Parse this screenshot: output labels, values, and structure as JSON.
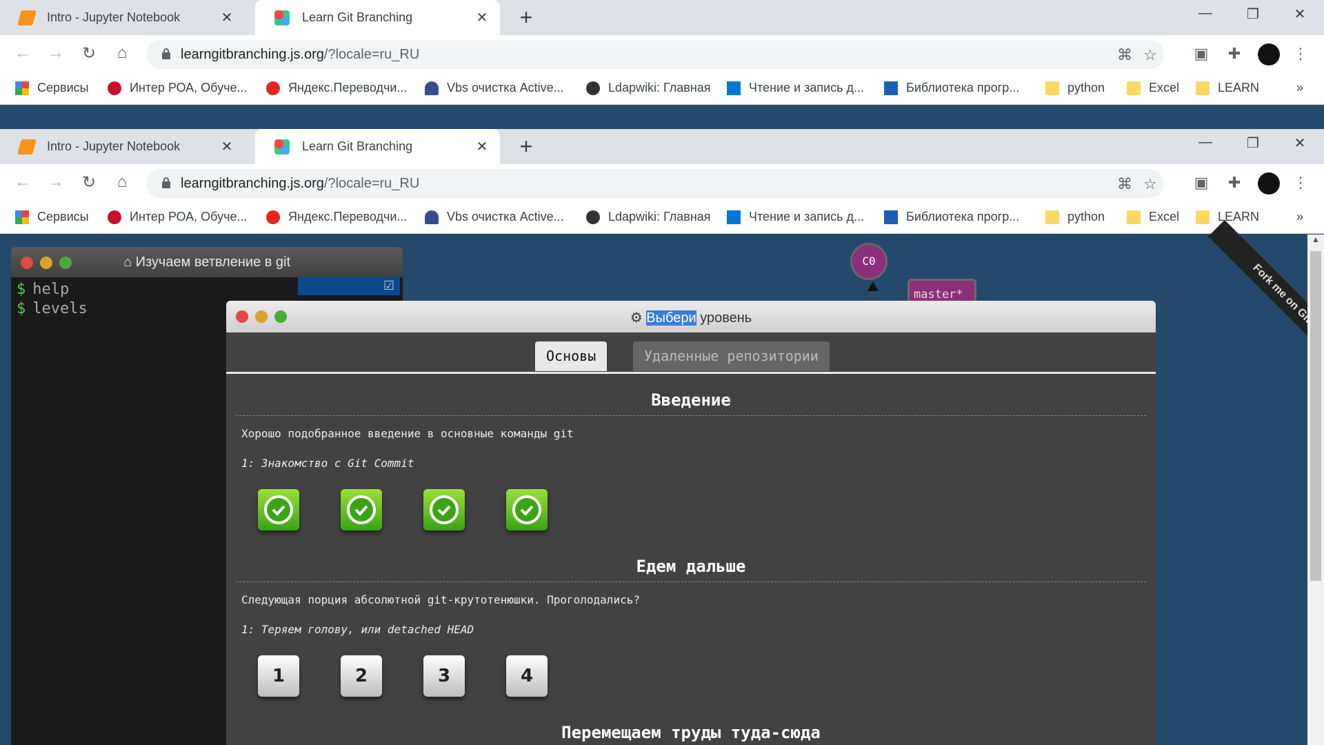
{
  "browser": {
    "tabs": [
      {
        "title": "Intro - Jupyter Notebook"
      },
      {
        "title": "Learn Git Branching"
      }
    ],
    "url_host": "learngitbranching.js.org",
    "url_path": "/?locale=ru_RU",
    "bookmarks": [
      {
        "label": "Сервисы"
      },
      {
        "label": "Интер РОА, Обуче..."
      },
      {
        "label": "Яндекс.Переводчи..."
      },
      {
        "label": "Vbs очистка Active..."
      },
      {
        "label": "Ldapwiki: Главная"
      },
      {
        "label": "Чтение и запись д..."
      },
      {
        "label": "Библиотека прогр..."
      },
      {
        "label": "python"
      },
      {
        "label": "Excel"
      },
      {
        "label": "LEARN"
      }
    ],
    "more_bookmarks": "»"
  },
  "terminal": {
    "title": "Изучаем ветвление в git",
    "lines": [
      "help",
      "levels"
    ],
    "prompt": "$"
  },
  "visual": {
    "commit": "C0",
    "branch": "master*",
    "ribbon": "Fork me on GitHub"
  },
  "modal": {
    "title_selected": "Выбери",
    "title_rest": " уровень",
    "tabs": [
      {
        "label": "Основы",
        "active": true
      },
      {
        "label": "Удаленные репозитории",
        "active": false
      }
    ],
    "sections": [
      {
        "title": "Введение",
        "about": "Хорошо подобранное введение в основные команды git",
        "level": "1: Знакомство с Git Commit",
        "levels": [
          {
            "status": "completed"
          },
          {
            "status": "completed"
          },
          {
            "status": "completed"
          },
          {
            "status": "completed"
          }
        ]
      },
      {
        "title": "Едем дальше",
        "about": "Следующая порция абсолютной git-крутотенюшки. Проголодались?",
        "level": "1: Теряем голову, или detached HEAD",
        "levels": [
          {
            "label": "1"
          },
          {
            "label": "2"
          },
          {
            "label": "3"
          },
          {
            "label": "4"
          }
        ]
      },
      {
        "title": "Перемещаем труды туда-сюда"
      }
    ]
  },
  "colors": {
    "page_bg": "#24496b",
    "completed_green": "#3aa316",
    "commit_purple": "#8b2f7a",
    "selection_blue": "#3a7be0"
  }
}
